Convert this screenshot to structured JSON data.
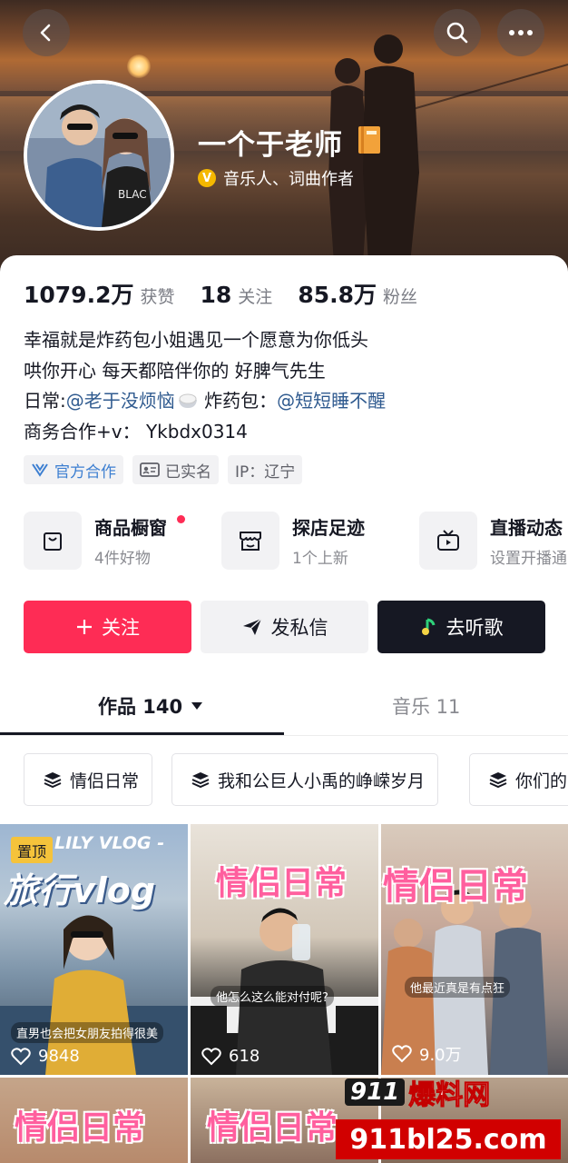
{
  "profile": {
    "nickname": "一个于老师",
    "verification": "音乐人、词曲作者"
  },
  "stats": [
    {
      "value": "1079.2万",
      "label": "获赞"
    },
    {
      "value": "18",
      "label": "关注"
    },
    {
      "value": "85.8万",
      "label": "粉丝"
    }
  ],
  "bio": {
    "line1": "幸福就是炸药包小姐遇见一个愿意为你低头",
    "line2": "哄你开心 每天都陪伴你的 好脾气先生",
    "line3_prefix": "日常:",
    "line3_mention1": "@老于没烦恼",
    "line3_mid": " 炸药包：",
    "line3_mention2": "@短短睡不醒",
    "line4": "商务合作+v：  Ykbdx0314"
  },
  "tags": [
    {
      "label": "官方合作",
      "icon": "official-icon"
    },
    {
      "label": "已实名",
      "icon": "id-card-icon"
    },
    {
      "label": "IP：辽宁"
    }
  ],
  "shortcuts": [
    {
      "title": "商品橱窗",
      "subtitle": "4件好物",
      "icon": "bag-icon"
    },
    {
      "title": "探店足迹",
      "subtitle": "1个上新",
      "icon": "shop-icon"
    },
    {
      "title": "直播动态",
      "subtitle": "设置开播通",
      "icon": "tv-icon"
    }
  ],
  "actions": {
    "follow": "关注",
    "message": "发私信",
    "listen": "去听歌"
  },
  "tabs": {
    "works": "作品 140",
    "music": "音乐 11"
  },
  "collections": [
    "情侣日常",
    "我和公巨人小禹的峥嵘岁月",
    "你们的"
  ],
  "videos": [
    {
      "likes": "9848",
      "pinned": "置顶",
      "headline": "LILY VLOG -",
      "title": "旅行vlog",
      "caption": "直男也会把女朋友拍得很美"
    },
    {
      "likes": "618",
      "title": "情侣日常",
      "caption": "他怎么这么能对付呢?"
    },
    {
      "likes": "9.0万",
      "title": "情侣日常",
      "caption": "他最近真是有点狂"
    },
    {
      "title": "情侣日常"
    },
    {
      "title": "情侣日常"
    }
  ],
  "watermark": {
    "brand_box": "911",
    "brand_cn": "爆料网",
    "url": "911bl25.com"
  },
  "colors": {
    "accent": "#fe2c55",
    "dark_button": "#161823",
    "mention": "#2f5a8f",
    "official_blue": "#3d7fd1",
    "pinned_badge": "#f5c33b"
  }
}
